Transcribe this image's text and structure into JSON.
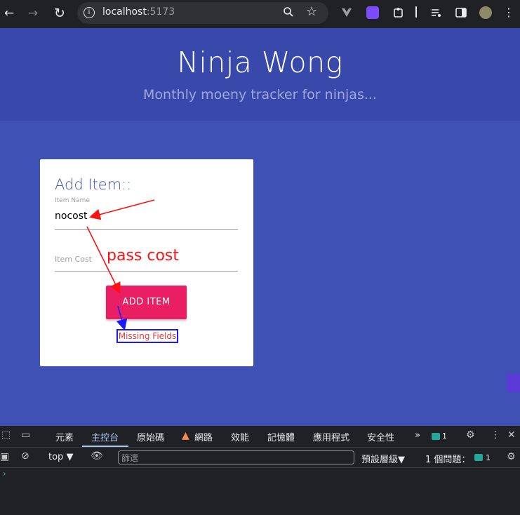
{
  "browser": {
    "url_host": "localhost",
    "url_port": ":5173",
    "back_icon": "←",
    "forward_icon": "→",
    "reload_icon": "↻"
  },
  "header": {
    "title": "Ninja Wong",
    "subtitle": "Monthly moeny tracker for ninjas..."
  },
  "form": {
    "title": "Add Item::",
    "name_label": "Item Name",
    "name_value": "nocost",
    "cost_placeholder": "Item Cost",
    "submit_label": "ADD ITEM",
    "error_text": "Missing Fields"
  },
  "annotation": {
    "text": "pass cost"
  },
  "devtools": {
    "tabs": [
      "元素",
      "主控台",
      "原始碼",
      "網路",
      "效能",
      "記憶體",
      "應用程式",
      "安全性"
    ],
    "active_tab": "主控台",
    "message_count": "1",
    "context": "top",
    "filter_placeholder": "篩選",
    "level": "預設層級",
    "issues": "1 個問題：",
    "issues_count": "1",
    "prompt": "›"
  },
  "colors": {
    "page_bg": "#3f51b5",
    "header_bg": "#3949ab",
    "accent": "#e91e63",
    "annotation_red": "#ff1111",
    "annotation_blue": "#1a1aff"
  }
}
